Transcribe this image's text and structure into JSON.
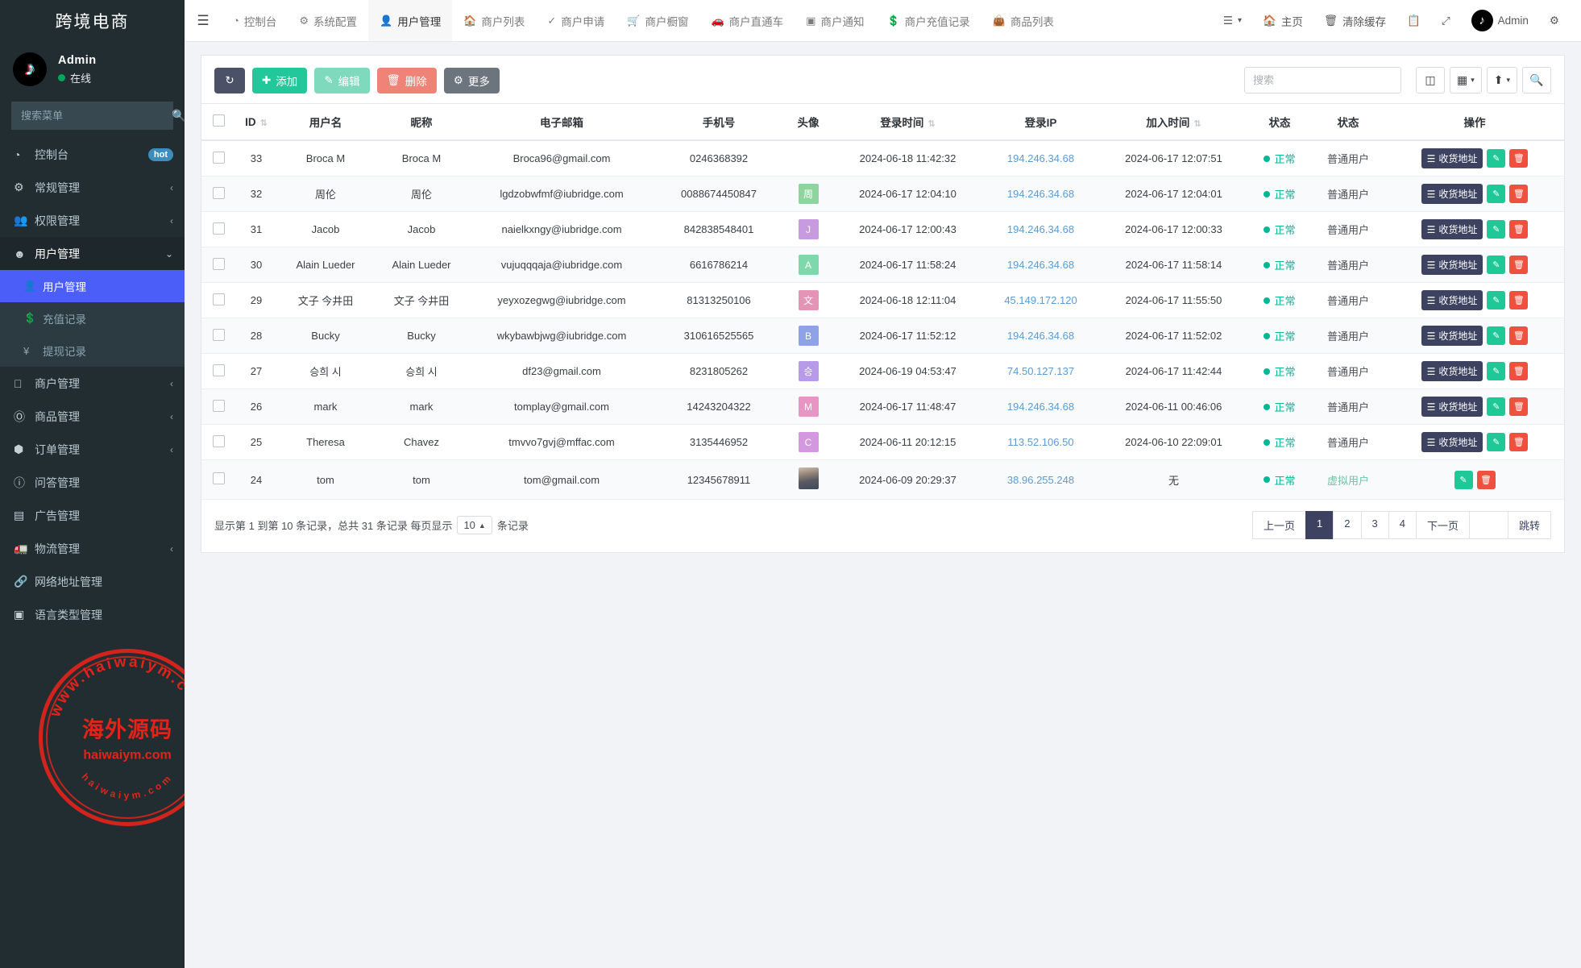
{
  "sidebar": {
    "brand": "跨境电商",
    "user": {
      "name": "Admin",
      "status": "在线",
      "avatar_icon": "tiktok-icon"
    },
    "search_placeholder": "搜索菜单",
    "search_icon": "search-icon",
    "items": [
      {
        "label": "控制台",
        "icon": "dashboard-icon",
        "badge": "hot",
        "caret": ""
      },
      {
        "label": "常规管理",
        "icon": "cogs-icon",
        "badge": "",
        "caret": "‹"
      },
      {
        "label": "权限管理",
        "icon": "users-icon",
        "badge": "",
        "caret": "‹"
      },
      {
        "label": "用户管理",
        "icon": "user-circle-icon",
        "badge": "",
        "caret": "⌄"
      },
      {
        "label": "商户管理",
        "icon": "apple-icon",
        "badge": "",
        "caret": "‹"
      },
      {
        "label": "商品管理",
        "icon": "product-icon",
        "badge": "",
        "caret": "‹"
      },
      {
        "label": "订单管理",
        "icon": "cube-icon",
        "badge": "",
        "caret": "‹"
      },
      {
        "label": "问答管理",
        "icon": "question-icon",
        "badge": "",
        "caret": ""
      },
      {
        "label": "广告管理",
        "icon": "ad-icon",
        "badge": "",
        "caret": ""
      },
      {
        "label": "物流管理",
        "icon": "truck-icon",
        "badge": "",
        "caret": "‹"
      },
      {
        "label": "网络地址管理",
        "icon": "link-icon",
        "badge": "",
        "caret": ""
      },
      {
        "label": "语言类型管理",
        "icon": "language-icon",
        "badge": "",
        "caret": ""
      }
    ],
    "submenu": [
      {
        "label": "用户管理",
        "icon": "user-icon",
        "active": true
      },
      {
        "label": "充值记录",
        "icon": "money-icon",
        "active": false
      },
      {
        "label": "提现记录",
        "icon": "yen-icon",
        "active": false
      }
    ],
    "watermark": {
      "top_arc": "www.haiwaiym.com",
      "center_cn": "海外源码",
      "center_en": "haiwaiym.com",
      "bottom_arc": "haiwaiym.com",
      "color": "#e2231a"
    }
  },
  "topnav": {
    "hamburger_icon": "bars-icon",
    "items": [
      {
        "label": "控制台",
        "icon": "dashboard-icon",
        "active": false
      },
      {
        "label": "系统配置",
        "icon": "gear-icon",
        "active": false
      },
      {
        "label": "用户管理",
        "icon": "user-icon",
        "active": true
      },
      {
        "label": "商户列表",
        "icon": "home-icon",
        "active": false
      },
      {
        "label": "商户申请",
        "icon": "shield-icon",
        "active": false
      },
      {
        "label": "商户橱窗",
        "icon": "cart-icon",
        "active": false
      },
      {
        "label": "商户直通车",
        "icon": "car-icon",
        "active": false
      },
      {
        "label": "商户通知",
        "icon": "notice-icon",
        "active": false
      },
      {
        "label": "商户充值记录",
        "icon": "money-icon",
        "active": false
      },
      {
        "label": "商品列表",
        "icon": "bag-icon",
        "active": false
      }
    ],
    "right": [
      {
        "label": "",
        "icon": "list-dropdown-icon"
      },
      {
        "label": "主页",
        "icon": "home-icon"
      },
      {
        "label": "清除缓存",
        "icon": "trash-icon"
      },
      {
        "label": "",
        "icon": "copy-icon"
      },
      {
        "label": "",
        "icon": "fullscreen-icon"
      },
      {
        "label": "Admin",
        "icon": "tiktok-avatar-icon"
      },
      {
        "label": "",
        "icon": "gears-icon"
      }
    ]
  },
  "toolbar": {
    "refresh_icon": "refresh-icon",
    "add_label": "添加",
    "edit_label": "编辑",
    "delete_label": "删除",
    "more_label": "更多",
    "search_placeholder": "搜索",
    "column_icon": "columns-icon",
    "grid_icon": "grid-icon",
    "export_icon": "export-icon",
    "search_icon": "search-icon"
  },
  "table": {
    "columns": [
      {
        "label": "",
        "key": "checkbox",
        "sortable": false
      },
      {
        "label": "ID",
        "key": "id",
        "sortable": true
      },
      {
        "label": "用户名",
        "key": "username",
        "sortable": false
      },
      {
        "label": "昵称",
        "key": "nickname",
        "sortable": false
      },
      {
        "label": "电子邮箱",
        "key": "email",
        "sortable": false
      },
      {
        "label": "手机号",
        "key": "phone",
        "sortable": false
      },
      {
        "label": "头像",
        "key": "avatar",
        "sortable": false
      },
      {
        "label": "登录时间",
        "key": "login_time",
        "sortable": true
      },
      {
        "label": "登录IP",
        "key": "login_ip",
        "sortable": false
      },
      {
        "label": "加入时间",
        "key": "join_time",
        "sortable": true
      },
      {
        "label": "状态",
        "key": "state",
        "sortable": false
      },
      {
        "label": "状态",
        "key": "user_type",
        "sortable": false
      },
      {
        "label": "操作",
        "key": "ops",
        "sortable": false
      }
    ],
    "op_addr_label": "收货地址",
    "op_edit_icon": "pencil-icon",
    "op_delete_icon": "trash-icon",
    "rows": [
      {
        "id": "33",
        "username": "Broca M",
        "nickname": "Broca M",
        "email": "Broca96@gmail.com",
        "phone": "0246368392",
        "avatar_letter": "",
        "avatar_color": "",
        "avatar_type": "none",
        "login_time": "2024-06-18 11:42:32",
        "login_ip": "194.246.34.68",
        "join_time": "2024-06-17 12:07:51",
        "state": "正常",
        "user_type": "普通用户",
        "has_addr": true
      },
      {
        "id": "32",
        "username": "周伦",
        "nickname": "周伦",
        "email": "lgdzobwfmf@iubridge.com",
        "phone": "0088674450847",
        "avatar_letter": "周",
        "avatar_color": "#8fd39f",
        "avatar_type": "letter",
        "login_time": "2024-06-17 12:04:10",
        "login_ip": "194.246.34.68",
        "join_time": "2024-06-17 12:04:01",
        "state": "正常",
        "user_type": "普通用户",
        "has_addr": true
      },
      {
        "id": "31",
        "username": "Jacob",
        "nickname": "Jacob",
        "email": "naielkxngy@iubridge.com",
        "phone": "842838548401",
        "avatar_letter": "J",
        "avatar_color": "#c89ae0",
        "avatar_type": "letter",
        "login_time": "2024-06-17 12:00:43",
        "login_ip": "194.246.34.68",
        "join_time": "2024-06-17 12:00:33",
        "state": "正常",
        "user_type": "普通用户",
        "has_addr": true
      },
      {
        "id": "30",
        "username": "Alain Lueder",
        "nickname": "Alain Lueder",
        "email": "vujuqqqaja@iubridge.com",
        "phone": "6616786214",
        "avatar_letter": "A",
        "avatar_color": "#7fd8ab",
        "avatar_type": "letter",
        "login_time": "2024-06-17 11:58:24",
        "login_ip": "194.246.34.68",
        "join_time": "2024-06-17 11:58:14",
        "state": "正常",
        "user_type": "普通用户",
        "has_addr": true
      },
      {
        "id": "29",
        "username": "文子 今井田",
        "nickname": "文子 今井田",
        "email": "yeyxozegwg@iubridge.com",
        "phone": "81313250106",
        "avatar_letter": "文",
        "avatar_color": "#e495b6",
        "avatar_type": "letter",
        "login_time": "2024-06-18 12:11:04",
        "login_ip": "45.149.172.120",
        "join_time": "2024-06-17 11:55:50",
        "state": "正常",
        "user_type": "普通用户",
        "has_addr": true
      },
      {
        "id": "28",
        "username": "Bucky",
        "nickname": "Bucky",
        "email": "wkybawbjwg@iubridge.com",
        "phone": "310616525565",
        "avatar_letter": "B",
        "avatar_color": "#8ea2e8",
        "avatar_type": "letter",
        "login_time": "2024-06-17 11:52:12",
        "login_ip": "194.246.34.68",
        "join_time": "2024-06-17 11:52:02",
        "state": "正常",
        "user_type": "普通用户",
        "has_addr": true
      },
      {
        "id": "27",
        "username": "승희 시",
        "nickname": "승희 시",
        "email": "df23@gmail.com",
        "phone": "8231805262",
        "avatar_letter": "승",
        "avatar_color": "#b79ae8",
        "avatar_type": "letter",
        "login_time": "2024-06-19 04:53:47",
        "login_ip": "74.50.127.137",
        "join_time": "2024-06-17 11:42:44",
        "state": "正常",
        "user_type": "普通用户",
        "has_addr": true
      },
      {
        "id": "26",
        "username": "mark",
        "nickname": "mark",
        "email": "tomplay@gmail.com",
        "phone": "14243204322",
        "avatar_letter": "M",
        "avatar_color": "#e796c4",
        "avatar_type": "letter",
        "login_time": "2024-06-17 11:48:47",
        "login_ip": "194.246.34.68",
        "join_time": "2024-06-11 00:46:06",
        "state": "正常",
        "user_type": "普通用户",
        "has_addr": true
      },
      {
        "id": "25",
        "username": "Theresa",
        "nickname": "Chavez",
        "email": "tmvvo7gvj@mffac.com",
        "phone": "3135446952",
        "avatar_letter": "C",
        "avatar_color": "#d398e0",
        "avatar_type": "letter",
        "login_time": "2024-06-11 20:12:15",
        "login_ip": "113.52.106.50",
        "join_time": "2024-06-10 22:09:01",
        "state": "正常",
        "user_type": "普通用户",
        "has_addr": true
      },
      {
        "id": "24",
        "username": "tom",
        "nickname": "tom",
        "email": "tom@gmail.com",
        "phone": "12345678911",
        "avatar_letter": "",
        "avatar_color": "",
        "avatar_type": "photo",
        "login_time": "2024-06-09 20:29:37",
        "login_ip": "38.96.255.248",
        "join_time": "无",
        "state": "正常",
        "user_type": "虚拟用户",
        "has_addr": false
      }
    ]
  },
  "footer": {
    "info_prefix": "显示第 1 到第 10 条记录，总共 31 条记录 每页显示",
    "page_size": "10",
    "info_suffix": "条记录",
    "prev_label": "上一页",
    "pages": [
      "1",
      "2",
      "3",
      "4"
    ],
    "active_page": "1",
    "next_label": "下一页",
    "jump_value": "",
    "jump_label": "跳转"
  }
}
